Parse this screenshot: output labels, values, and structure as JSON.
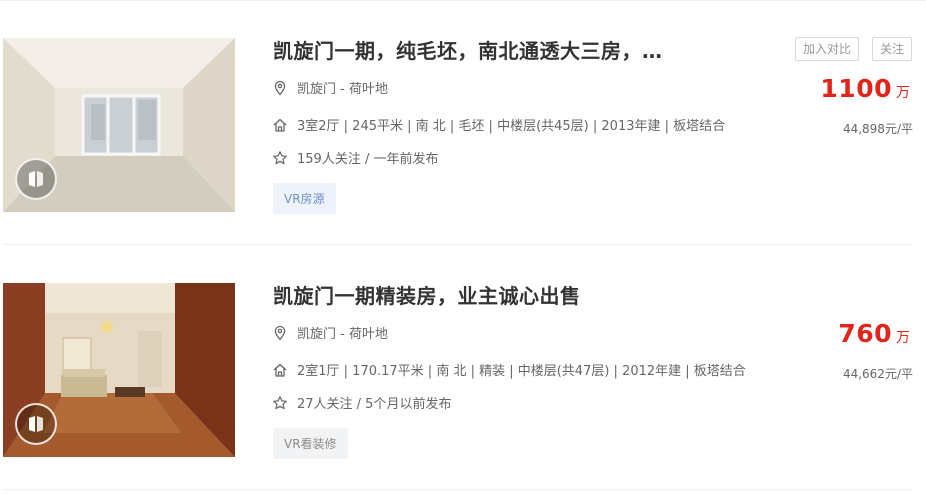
{
  "listings": [
    {
      "title": "凯旋门一期，纯毛坯，南北通透大三房，…",
      "location": "凯旋门 - 荷叶地",
      "details": "3室2厅 | 245平米 | 南 北 | 毛坯 | 中楼层(共45层) | 2013年建 | 板塔结合",
      "follow": "159人关注 / 一年前发布",
      "tag": "VR房源",
      "price": "1100",
      "price_unit": "万",
      "unit_price": "44,898元/平",
      "compare_label": "加入对比",
      "follow_label": "关注"
    },
    {
      "title": "凯旋门一期精装房，业主诚心出售",
      "location": "凯旋门 - 荷叶地",
      "details": "2室1厅 | 170.17平米 | 南 北 | 精装 | 中楼层(共47层) | 2012年建 | 板塔结合",
      "follow": "27人关注 / 5个月以前发布",
      "tag": "VR看装修",
      "price": "760",
      "price_unit": "万",
      "unit_price": "44,662元/平"
    }
  ],
  "icons": {
    "location": "location-pin-icon",
    "house": "house-icon",
    "star": "star-icon",
    "vr": "vr-badge-icon"
  },
  "colors": {
    "price": "#e1251b",
    "tag_blue": "#6f8fc8"
  }
}
